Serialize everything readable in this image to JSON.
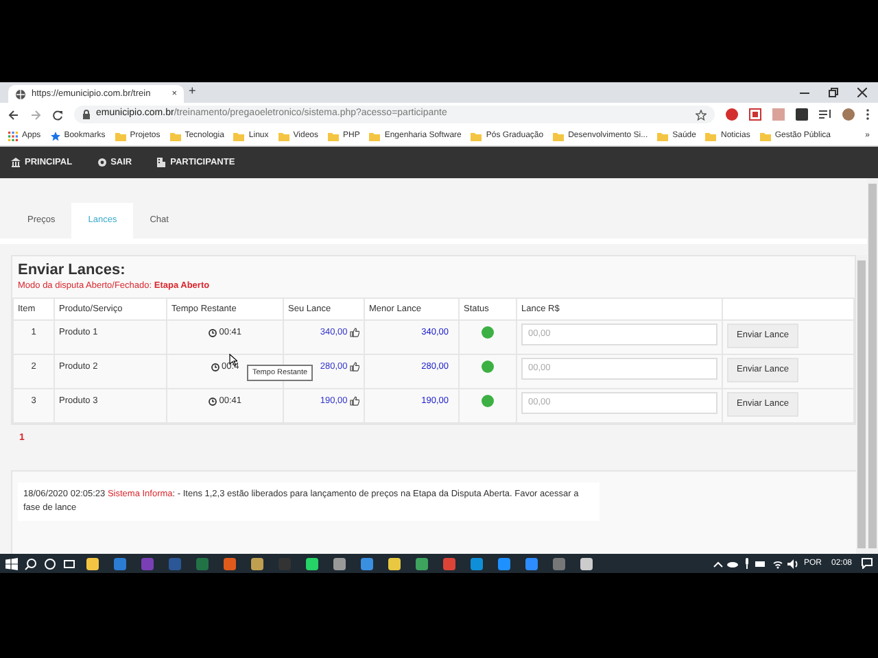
{
  "browser": {
    "tab_title": "https://emunicipio.com.br/trein",
    "tab_close": "×",
    "new_tab": "+",
    "url_domain": "emunicipio.com.br",
    "url_path": "/treinamento/pregaoeletronico/sistema.php?acesso=participante",
    "bookmarks": [
      {
        "label": "Apps",
        "kind": "apps"
      },
      {
        "label": "Bookmarks",
        "kind": "star"
      },
      {
        "label": "Projetos",
        "kind": "folder"
      },
      {
        "label": "Tecnologia",
        "kind": "folder"
      },
      {
        "label": "Linux",
        "kind": "folder"
      },
      {
        "label": "Videos",
        "kind": "folder"
      },
      {
        "label": "PHP",
        "kind": "folder"
      },
      {
        "label": "Engenharia Software",
        "kind": "folder"
      },
      {
        "label": "Pós Graduação",
        "kind": "folder"
      },
      {
        "label": "Desenvolvimento Si...",
        "kind": "folder"
      },
      {
        "label": "Saúde",
        "kind": "folder"
      },
      {
        "label": "Noticias",
        "kind": "folder"
      },
      {
        "label": "Gestão Pública",
        "kind": "folder"
      }
    ],
    "bookmarks_more": "»"
  },
  "navbar": [
    {
      "label": "PRINCIPAL",
      "kind": "bank"
    },
    {
      "label": "SAIR",
      "kind": "gear"
    },
    {
      "label": "PARTICIPANTE",
      "kind": "building"
    }
  ],
  "tabs": [
    {
      "label": "Preços",
      "selected": false
    },
    {
      "label": "Lances",
      "selected": true
    },
    {
      "label": "Chat",
      "selected": false
    }
  ],
  "panel": {
    "title": "Enviar Lances:",
    "mode": "Modo da disputa Aberto/Fechado: **Etapa Aberto**",
    "columns": [
      "Item",
      "Produto/Serviço",
      "Tempo Restante",
      "Seu Lance",
      "Menor Lance",
      "Status",
      "Lance R$"
    ],
    "rows": [
      {
        "item": "1",
        "product": "Produto 1",
        "time": "00:41",
        "bid": "340,00",
        "lowest": "340,00",
        "color": "#3cb043",
        "placeholder": "00,00",
        "button": "Enviar Lance"
      },
      {
        "item": "2",
        "product": "Produto 2",
        "time": "00:4",
        "bid": "280,00",
        "lowest": "280,00",
        "color": "#3cb043",
        "placeholder": "00,00",
        "button": "Enviar Lance"
      },
      {
        "item": "3",
        "product": "Produto 3",
        "time": "00:41",
        "bid": "190,00",
        "lowest": "190,00",
        "color": "#3cb043",
        "placeholder": "00,00",
        "button": "Enviar Lance"
      }
    ],
    "tooltip": "Tempo Restante",
    "pages": [
      {
        "label": "1",
        "selected": true
      }
    ]
  },
  "message": {
    "date": "18/06/2020 02:05:23",
    "sender": "Sistema Informa",
    "text": ": - Itens 1,2,3 estão liberados para lançamento de preços na Etapa da Disputa Aberta. Favor acessar a fase de lance"
  },
  "taskbar": {
    "language": "POR",
    "clock": "02:08"
  }
}
